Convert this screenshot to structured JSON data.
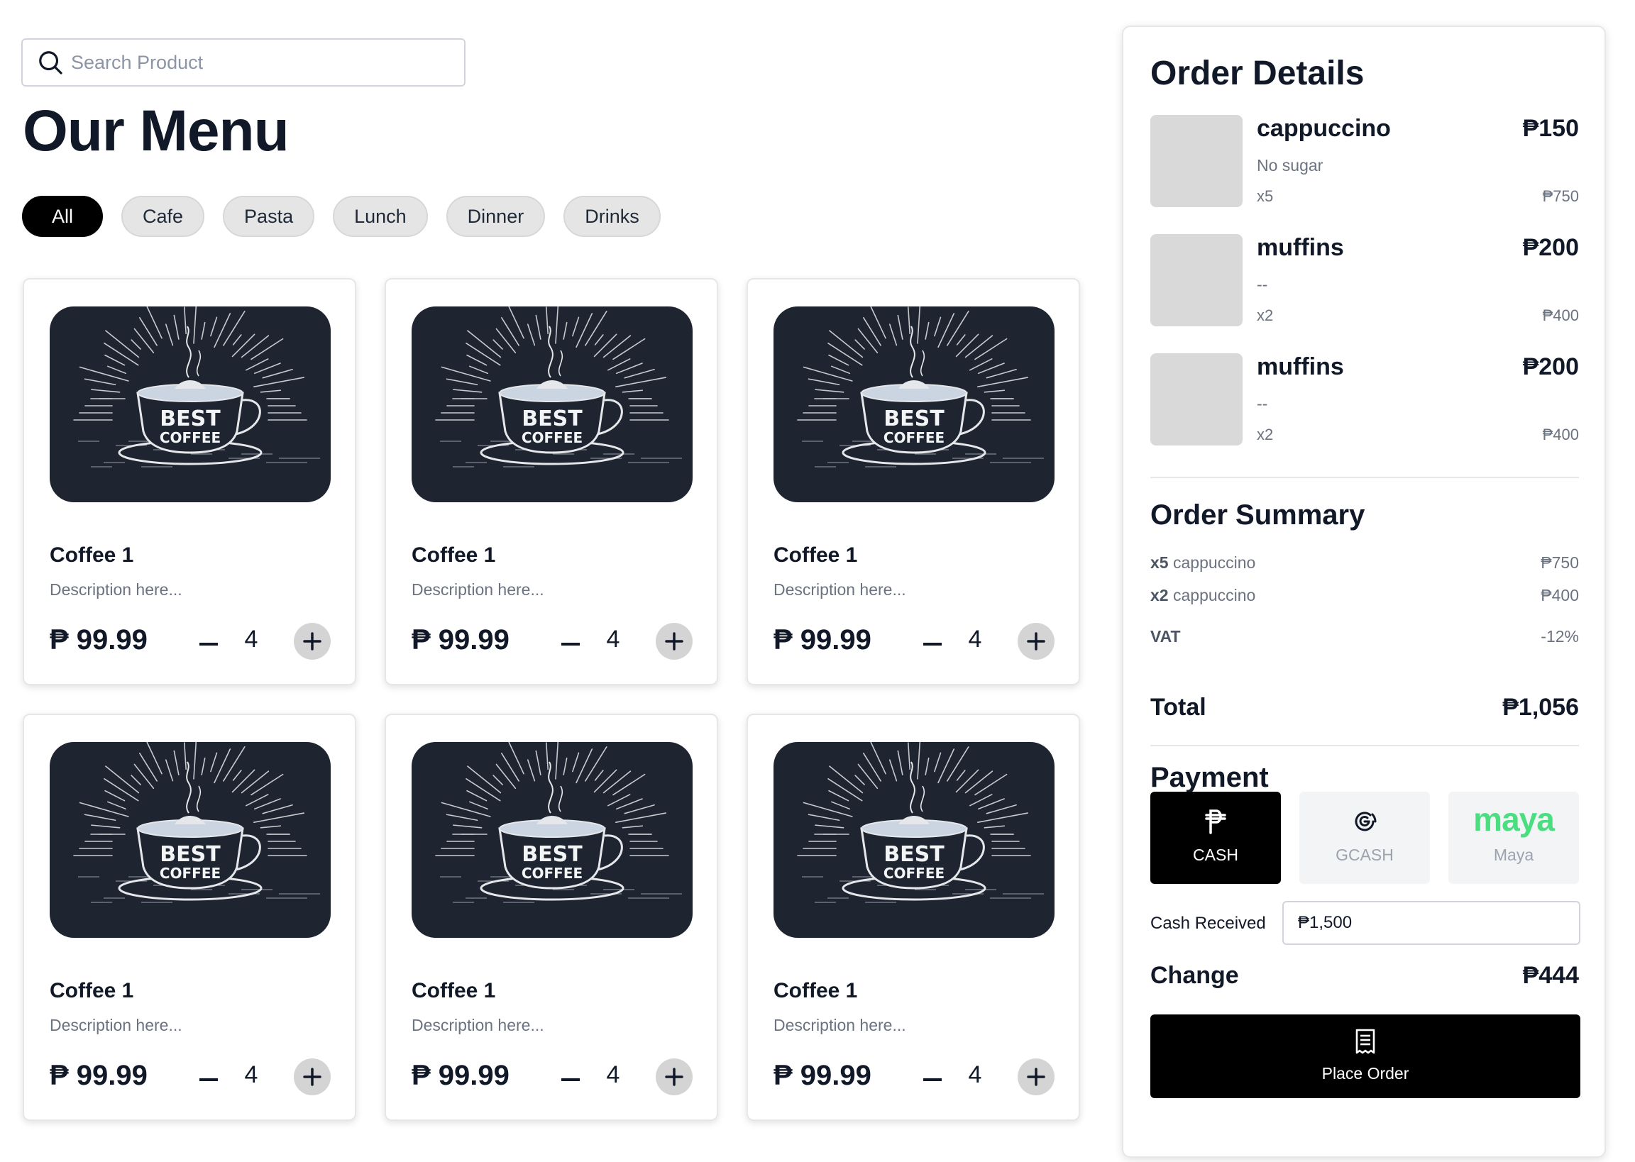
{
  "search": {
    "placeholder": "Search Product",
    "icon": "search-icon"
  },
  "menu": {
    "title": "Our Menu",
    "categories": [
      {
        "label": "All",
        "active": true
      },
      {
        "label": "Cafe",
        "active": false
      },
      {
        "label": "Pasta",
        "active": false
      },
      {
        "label": "Lunch",
        "active": false
      },
      {
        "label": "Dinner",
        "active": false
      },
      {
        "label": "Drinks",
        "active": false
      }
    ],
    "products": [
      {
        "name": "Coffee 1",
        "description": "Description here...",
        "price": "₱ 99.99",
        "quantity": "4",
        "image_line1": "BEST",
        "image_line2": "COFFEE"
      },
      {
        "name": "Coffee 1",
        "description": "Description here...",
        "price": "₱ 99.99",
        "quantity": "4",
        "image_line1": "BEST",
        "image_line2": "COFFEE"
      },
      {
        "name": "Coffee 1",
        "description": "Description here...",
        "price": "₱ 99.99",
        "quantity": "4",
        "image_line1": "BEST",
        "image_line2": "COFFEE"
      },
      {
        "name": "Coffee 1",
        "description": "Description here...",
        "price": "₱ 99.99",
        "quantity": "4",
        "image_line1": "BEST",
        "image_line2": "COFFEE"
      },
      {
        "name": "Coffee 1",
        "description": "Description here...",
        "price": "₱ 99.99",
        "quantity": "4",
        "image_line1": "BEST",
        "image_line2": "COFFEE"
      },
      {
        "name": "Coffee 1",
        "description": "Description here...",
        "price": "₱ 99.99",
        "quantity": "4",
        "image_line1": "BEST",
        "image_line2": "COFFEE"
      }
    ]
  },
  "order": {
    "title": "Order Details",
    "items": [
      {
        "name": "cappuccino",
        "price": "₱150",
        "note": "No sugar",
        "qty": "x5",
        "subtotal": "₱750"
      },
      {
        "name": "muffins",
        "price": "₱200",
        "note": "--",
        "qty": "x2",
        "subtotal": "₱400"
      },
      {
        "name": "muffins",
        "price": "₱200",
        "note": "--",
        "qty": "x2",
        "subtotal": "₱400"
      }
    ]
  },
  "summary": {
    "title": "Order Summary",
    "lines": [
      {
        "qty": "x5",
        "name": "cappuccino",
        "amount": "₱750"
      },
      {
        "qty": "x2",
        "name": "cappuccino",
        "amount": "₱400"
      }
    ],
    "vat_label": "VAT",
    "vat_value": "-12%",
    "total_label": "Total",
    "total_value": "₱1,056"
  },
  "payment": {
    "title": "Payment",
    "methods": [
      {
        "label": "CASH",
        "icon": "peso-icon",
        "active": true
      },
      {
        "label": "GCASH",
        "icon": "gcash-icon",
        "active": false
      },
      {
        "label": "Maya",
        "logo_text": "maya",
        "icon": "maya-logo",
        "active": false
      }
    ],
    "cash_received_label": "Cash Received",
    "cash_received_value": "₱1,500",
    "change_label": "Change",
    "change_value": "₱444",
    "place_order_label": "Place Order",
    "place_order_icon": "receipt-icon"
  },
  "colors": {
    "accent": "#000000",
    "card_image_bg": "#1f2530",
    "maya_green": "#4ade80",
    "muted_text": "#6b7280"
  }
}
